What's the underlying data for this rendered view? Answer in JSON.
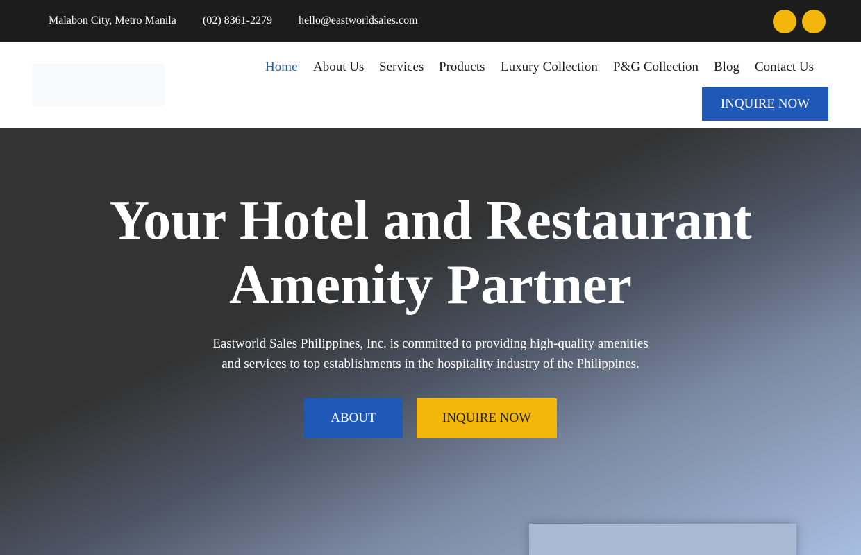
{
  "topbar": {
    "location": "Malabon City, Metro Manila",
    "phone": "(02) 8361-2279",
    "email": "hello@eastworldsales.com",
    "social_icons": [
      "social-icon",
      "social-icon"
    ],
    "accent_color": "#f3b70c",
    "background_color": "#1c1c1c"
  },
  "header": {
    "nav": [
      {
        "label": "Home",
        "active": true
      },
      {
        "label": "About Us"
      },
      {
        "label": "Services"
      },
      {
        "label": "Products"
      },
      {
        "label": "Luxury Collection"
      },
      {
        "label": "P&G Collection"
      },
      {
        "label": "Blog"
      },
      {
        "label": "Contact Us"
      }
    ],
    "cta_label": "INQUIRE NOW",
    "active_color": "#1f5aa6",
    "cta_color": "#1f58b7"
  },
  "hero": {
    "title_line1": "Your Hotel and Restaurant",
    "title_line2": "Amenity Partner",
    "subtitle_line1": "Eastworld Sales Philippines, Inc. is committed to providing high-quality amenities",
    "subtitle_line2": "and services to top establishments in the hospitality industry of the Philippines.",
    "about_label": "ABOUT",
    "inquire_label": "INQUIRE NOW",
    "about_color": "#1f58b7",
    "inquire_color": "#f3b70c"
  }
}
